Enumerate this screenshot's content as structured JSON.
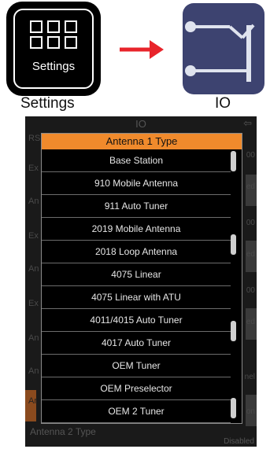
{
  "tutorial": {
    "settings_icon_caption": "Settings",
    "label_left": "Settings",
    "label_right": "IO"
  },
  "screen": {
    "title": "IO",
    "back_glyph": "⇦",
    "background_rows": [
      "RS",
      "Ex",
      "An",
      "Ex",
      "An",
      "Ex",
      "An",
      "An",
      "Ar"
    ],
    "background_right": [
      "00",
      "ed",
      "00",
      "ed",
      "00",
      "ed",
      "nel",
      "on"
    ],
    "bottom_label": "Antenna 2 Type",
    "bottom_value": "Disabled"
  },
  "dropdown": {
    "header": "Antenna 1 Type",
    "items": [
      "Base Station",
      "910 Mobile Antenna",
      "911 Auto Tuner",
      "2019 Mobile Antenna",
      "2018 Loop Antenna",
      "4075 Linear",
      "4075 Linear with ATU",
      "4011/4015 Auto Tuner",
      "4017 Auto Tuner",
      "OEM Tuner",
      "OEM Preselector",
      "OEM 2 Tuner"
    ]
  },
  "colors": {
    "accent": "#f08a2c",
    "io_icon_bg": "#3d4370",
    "arrow": "#e8242b"
  }
}
